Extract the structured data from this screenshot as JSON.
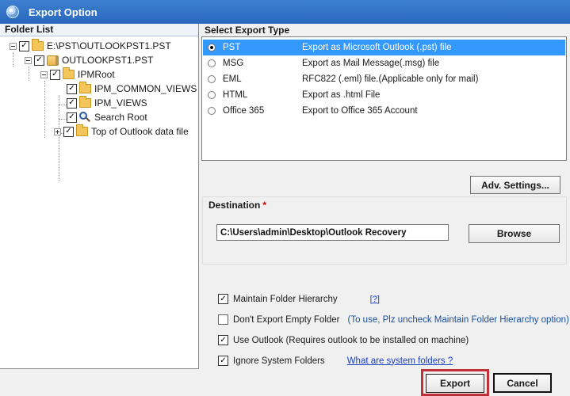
{
  "window": {
    "title": "Export Option"
  },
  "folder_list": {
    "title": "Folder List",
    "nodes": [
      {
        "label": "E:\\PST\\OUTLOOKPST1.PST"
      },
      {
        "label": "OUTLOOKPST1.PST"
      },
      {
        "label": "IPMRoot"
      },
      {
        "label": "IPM_COMMON_VIEWS"
      },
      {
        "label": "IPM_VIEWS"
      },
      {
        "label": "Search Root"
      },
      {
        "label": "Top of Outlook data file"
      }
    ]
  },
  "export_type": {
    "title": "Select Export Type",
    "options": [
      {
        "type": "PST",
        "description": "Export as Microsoft Outlook (.pst) file",
        "selected": true
      },
      {
        "type": "MSG",
        "description": "Export as Mail Message(.msg) file",
        "selected": false
      },
      {
        "type": "EML",
        "description": "RFC822 (.eml) file.(Applicable only for mail)",
        "selected": false
      },
      {
        "type": "HTML",
        "description": "Export as .html File",
        "selected": false
      },
      {
        "type": "Office 365",
        "description": "Export to Office 365 Account",
        "selected": false
      }
    ]
  },
  "adv_settings_label": "Adv. Settings...",
  "destination": {
    "label": "Destination",
    "required_mark": "*",
    "path": "C:\\Users\\admin\\Desktop\\Outlook Recovery",
    "browse_label": "Browse"
  },
  "options": {
    "maintain_hierarchy": {
      "label": "Maintain Folder Hierarchy",
      "checked": true,
      "help": "[?]"
    },
    "no_empty_folder": {
      "label": "Don't Export Empty Folder",
      "checked": false,
      "note": "(To use, Plz uncheck Maintain Folder Hierarchy option)"
    },
    "use_outlook": {
      "label": "Use Outlook (Requires outlook to be installed on machine)",
      "checked": true
    },
    "ignore_system": {
      "label": "Ignore System Folders",
      "checked": true,
      "link": "What are system folders ?"
    }
  },
  "footer": {
    "export_label": "Export",
    "cancel_label": "Cancel"
  },
  "colors": {
    "titlebar": "#2a68bd",
    "selection": "#3399ff",
    "export_highlight": "#c03038"
  }
}
